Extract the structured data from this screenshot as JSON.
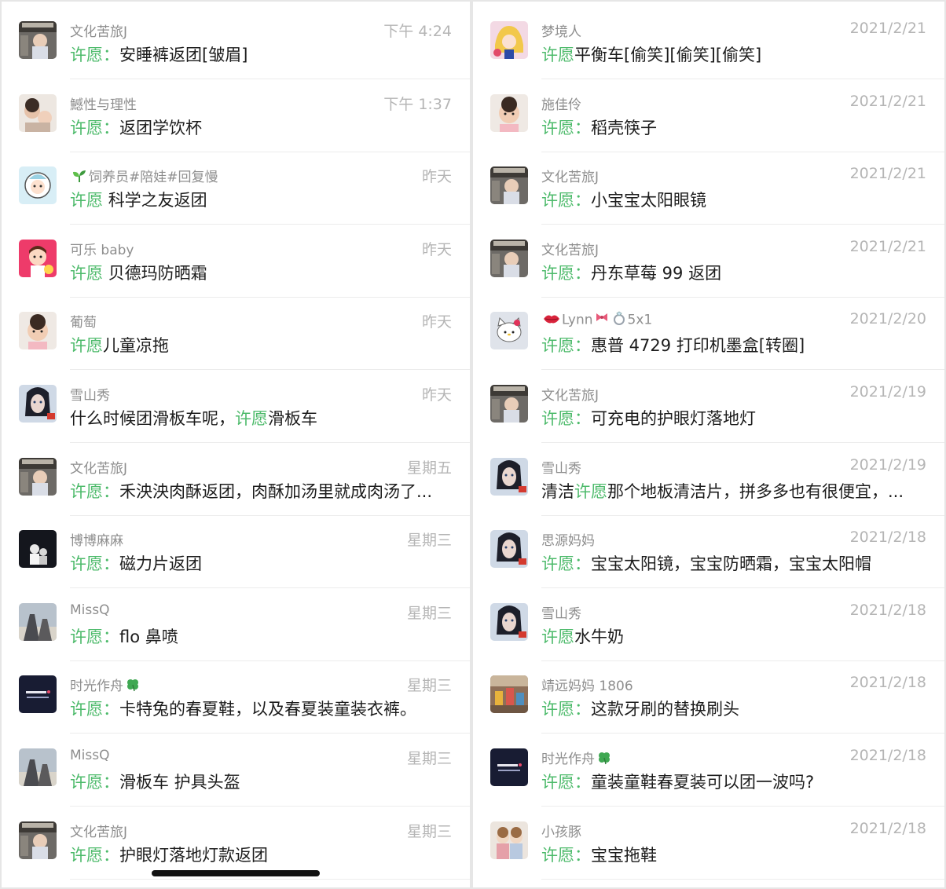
{
  "left_chats": [
    {
      "avatar": "baby-photo-avatar-icon",
      "name": "文化苦旅J",
      "time": "下午 4:24",
      "pre": "",
      "keyword": "许愿",
      "sep": "：",
      "text": "安睡裤返团[皱眉]"
    },
    {
      "avatar": "family-photo-avatar-icon",
      "name": "鱤性与理性",
      "time": "下午 1:37",
      "pre": "",
      "keyword": "许愿",
      "sep": "：",
      "text": "返团学饮杯"
    },
    {
      "avatar": "cartoon-girl-avatar-icon",
      "name": "饲养员#陪娃#回复慢",
      "name_prefix_icon": "sprout-icon",
      "time": "昨天",
      "pre": "",
      "keyword": "许愿",
      "sep": " ",
      "text": "科学之友返团"
    },
    {
      "avatar": "cartoon-kid-avatar-icon",
      "name": "可乐 baby",
      "time": "昨天",
      "pre": "",
      "keyword": "许愿",
      "sep": " ",
      "text": "贝德玛防晒霜"
    },
    {
      "avatar": "baby-face-avatar-icon",
      "name": "葡萄",
      "time": "昨天",
      "pre": "",
      "keyword": "许愿",
      "sep": "",
      "text": "儿童凉拖"
    },
    {
      "avatar": "doll-avatar-icon",
      "name": "雪山秀",
      "time": "昨天",
      "pre": "什么时候团滑板车呢，",
      "keyword": "许愿",
      "sep": "",
      "text": "滑板车"
    },
    {
      "avatar": "baby-photo-avatar-icon",
      "name": "文化苦旅J",
      "time": "星期五",
      "pre": "",
      "keyword": "许愿",
      "sep": "：",
      "text": "禾泱泱肉酥返团，肉酥加汤里就成肉汤了..."
    },
    {
      "avatar": "dark-photo-avatar-icon",
      "name": "博博麻麻",
      "time": "星期三",
      "pre": "",
      "keyword": "许愿",
      "sep": "：",
      "text": "磁力片返团"
    },
    {
      "avatar": "sky-photo-avatar-icon",
      "name": "MissQ",
      "time": "星期三",
      "pre": "",
      "keyword": "许愿",
      "sep": "：",
      "text": "flo 鼻喷"
    },
    {
      "avatar": "text-card-avatar-icon",
      "name": "时光作舟",
      "name_suffix_icon": "clover-icon",
      "time": "星期三",
      "pre": "",
      "keyword": "许愿",
      "sep": "：",
      "text": "卡特兔的春夏鞋，以及春夏装童装衣裤。"
    },
    {
      "avatar": "sky-photo-avatar-icon",
      "name": "MissQ",
      "time": "星期三",
      "pre": "",
      "keyword": "许愿",
      "sep": "：",
      "text": "滑板车 护具头盔"
    },
    {
      "avatar": "baby-photo-avatar-icon",
      "name": "文化苦旅J",
      "time": "星期三",
      "pre": "",
      "keyword": "许愿",
      "sep": "：",
      "text": "护眼灯落地灯款返团"
    }
  ],
  "right_chats": [
    {
      "avatar": "anime-avatar-icon",
      "name": "梦境人",
      "time": "2021/2/21",
      "pre": "",
      "keyword": "许愿",
      "sep": "",
      "text": "平衡车[偷笑][偷笑][偷笑]"
    },
    {
      "avatar": "baby-face-avatar-icon",
      "name": "施佳伶",
      "time": "2021/2/21",
      "pre": "",
      "keyword": "许愿",
      "sep": "：",
      "text": "稻壳筷子"
    },
    {
      "avatar": "baby-photo-avatar-icon",
      "name": "文化苦旅J",
      "time": "2021/2/21",
      "pre": "",
      "keyword": "许愿",
      "sep": "：",
      "text": "小宝宝太阳眼镜"
    },
    {
      "avatar": "baby-photo-avatar-icon",
      "name": "文化苦旅J",
      "time": "2021/2/21",
      "pre": "",
      "keyword": "许愿",
      "sep": "：",
      "text": "丹东草莓 99 返团"
    },
    {
      "avatar": "hello-kitty-avatar-icon",
      "name": "Lynn",
      "name_prefix_icon": "lips-icon",
      "name_suffix": "5x1",
      "time": "2021/2/20",
      "pre": "",
      "keyword": "许愿",
      "sep": "：",
      "text": "惠普 4729 打印机墨盒[转圈]"
    },
    {
      "avatar": "baby-photo-avatar-icon",
      "name": "文化苦旅J",
      "time": "2021/2/19",
      "pre": "",
      "keyword": "许愿",
      "sep": "：",
      "text": "可充电的护眼灯落地灯"
    },
    {
      "avatar": "doll-avatar-icon",
      "name": "雪山秀",
      "time": "2021/2/19",
      "pre": "清洁",
      "keyword": "许愿",
      "sep": "",
      "text": "那个地板清洁片，拼多多也有很便宜，..."
    },
    {
      "avatar": "doll-avatar-icon",
      "name": "思源妈妈",
      "time": "2021/2/18",
      "pre": "",
      "keyword": "许愿",
      "sep": "：",
      "text": "宝宝太阳镜，宝宝防晒霜，宝宝太阳帽"
    },
    {
      "avatar": "doll-avatar-icon",
      "name": "雪山秀",
      "time": "2021/2/18",
      "pre": "",
      "keyword": "许愿",
      "sep": "",
      "text": "水牛奶"
    },
    {
      "avatar": "toys-photo-avatar-icon",
      "name": "靖远妈妈 1806",
      "time": "2021/2/18",
      "pre": "",
      "keyword": "许愿",
      "sep": "：",
      "text": "这款牙刷的替换刷头"
    },
    {
      "avatar": "text-card-avatar-icon",
      "name": "时光作舟",
      "name_suffix_icon": "clover-icon",
      "time": "2021/2/18",
      "pre": "",
      "keyword": "许愿",
      "sep": "：",
      "text": "童装童鞋春夏装可以团一波吗?"
    },
    {
      "avatar": "dolls-photo-avatar-icon",
      "name": "小孩豚",
      "time": "2021/2/18",
      "pre": "",
      "keyword": "许愿",
      "sep": "：",
      "text": "宝宝拖鞋"
    }
  ],
  "colors": {
    "keyword": "#4cba6a",
    "name": "#8e8e8e",
    "time": "#b5b5b5",
    "message": "#1c1c1c"
  }
}
